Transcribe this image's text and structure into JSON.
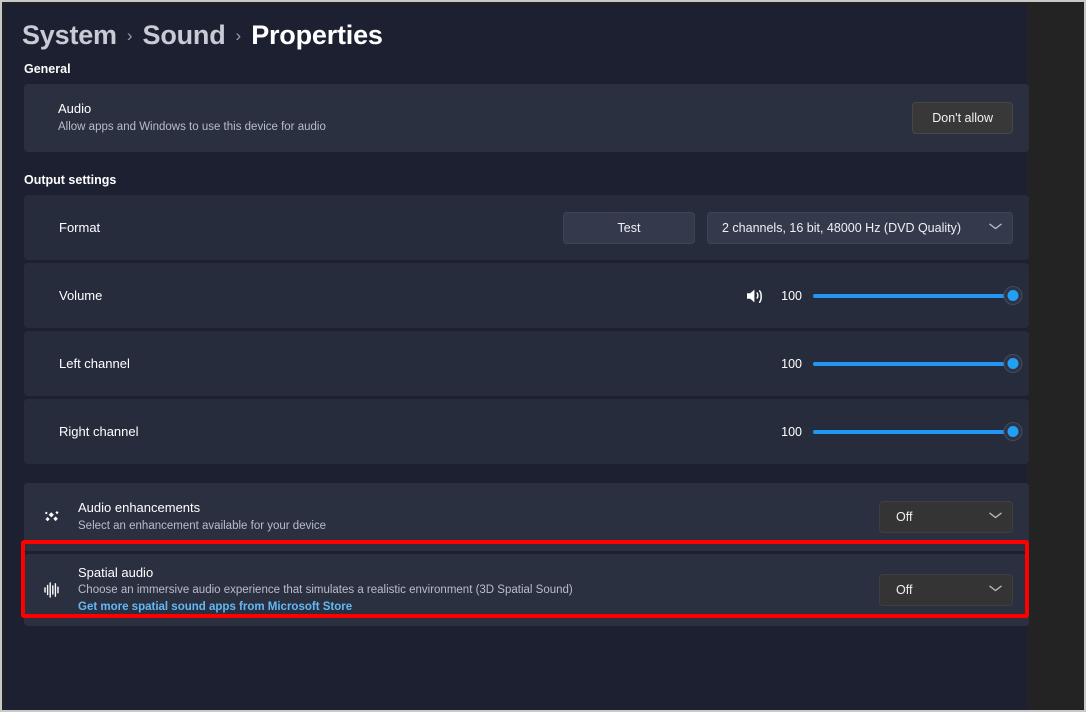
{
  "breadcrumb": {
    "items": [
      "System",
      "Sound",
      "Properties"
    ],
    "separator": "›"
  },
  "sections": {
    "general": {
      "title": "General",
      "audio": {
        "title": "Audio",
        "subtitle": "Allow apps and Windows to use this device for audio",
        "button_label": "Don't allow"
      }
    },
    "output": {
      "title": "Output settings",
      "format": {
        "label": "Format",
        "test_button": "Test",
        "value": "2 channels, 16 bit, 48000 Hz (DVD Quality)"
      },
      "volume": {
        "label": "Volume",
        "value": "100",
        "icon": "speaker-wave-icon"
      },
      "left_channel": {
        "label": "Left channel",
        "value": "100"
      },
      "right_channel": {
        "label": "Right channel",
        "value": "100"
      }
    },
    "enhancements": {
      "title": "Audio enhancements",
      "subtitle": "Select an enhancement available for your device",
      "value": "Off",
      "icon": "sparkle-diamonds-icon"
    },
    "spatial": {
      "title": "Spatial audio",
      "subtitle": "Choose an immersive audio experience that simulates a realistic environment (3D Spatial Sound)",
      "link": "Get more spatial sound apps from Microsoft Store",
      "value": "Off",
      "icon": "waveform-icon"
    }
  },
  "colors": {
    "accent_blue": "#2196f3",
    "link_blue": "#62b8f5",
    "highlight_red": "#ff0000",
    "card_bg": "#2b3040",
    "page_bg": "#1c2030"
  },
  "chevron": "⌄"
}
